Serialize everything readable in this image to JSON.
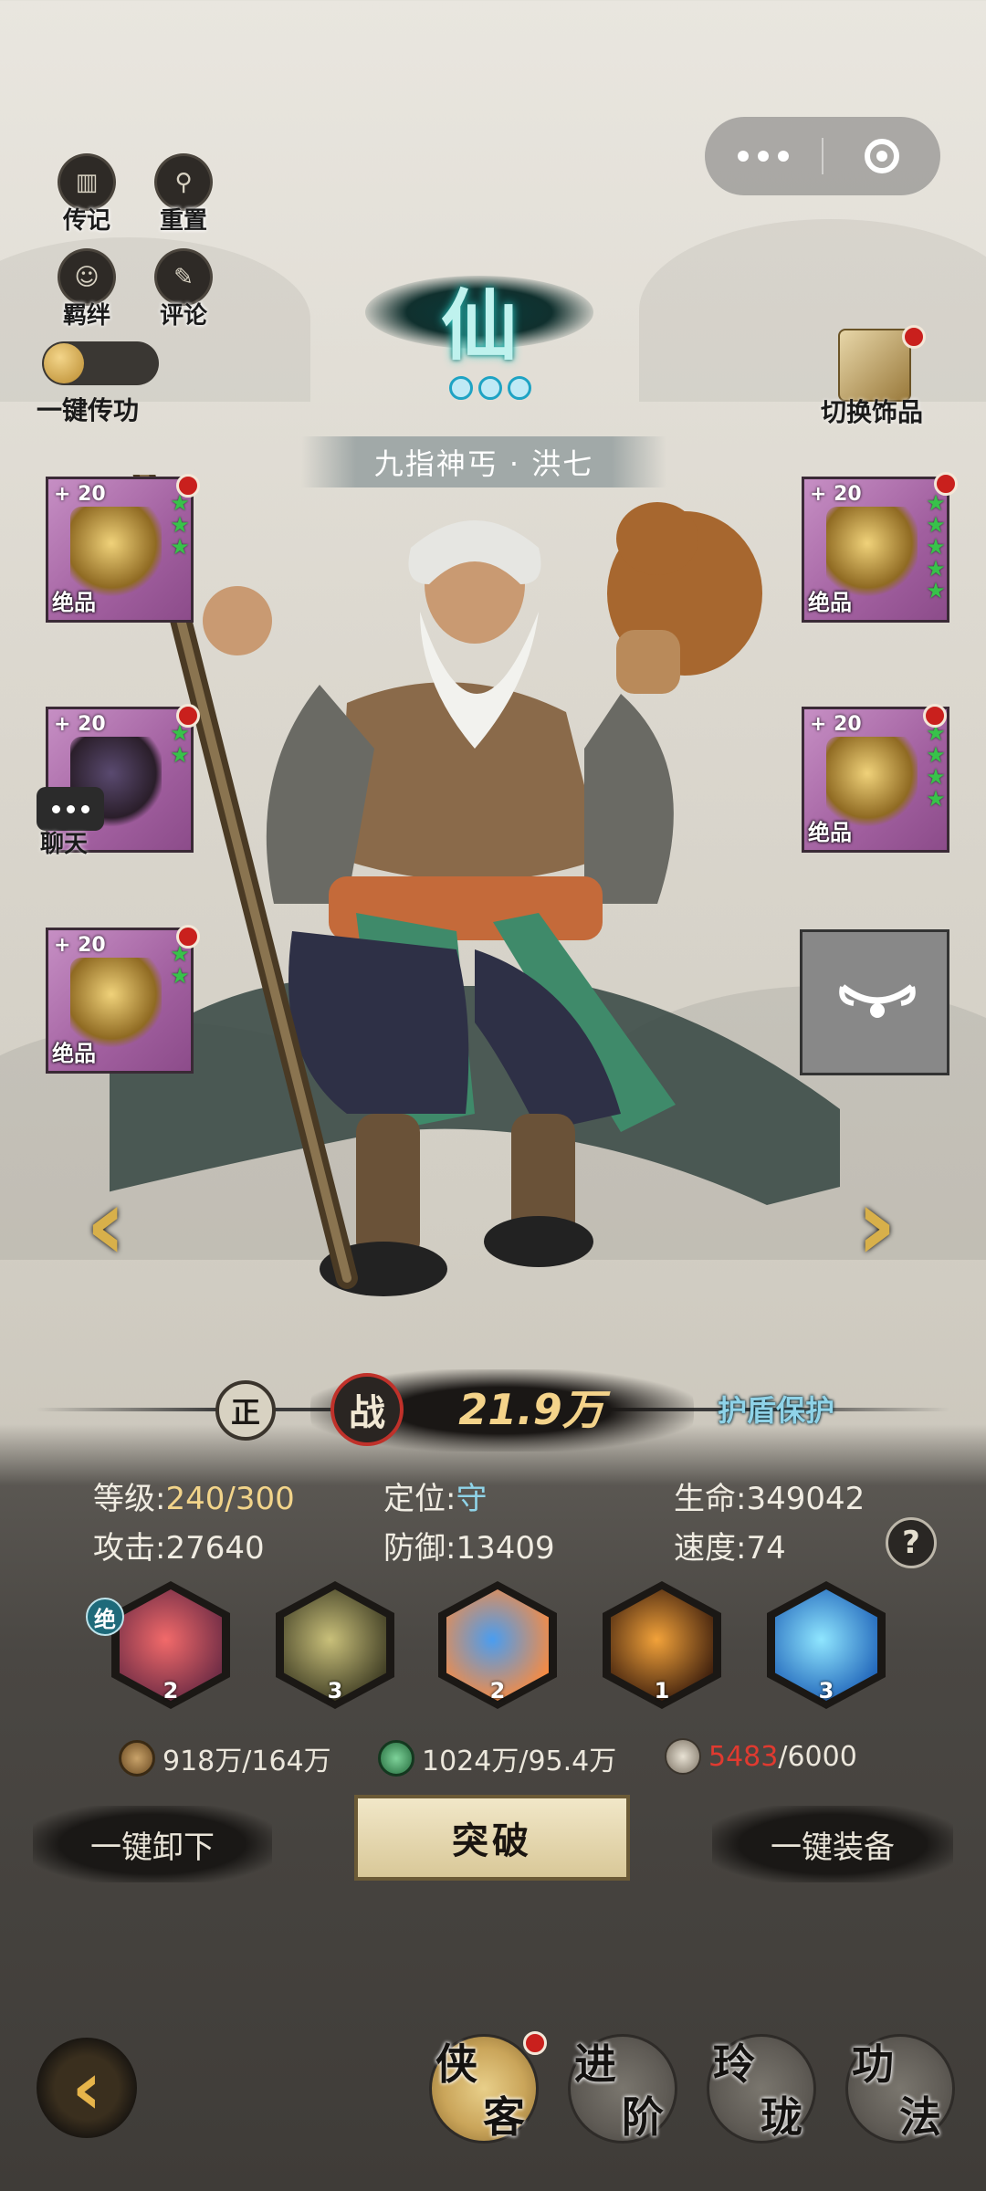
{
  "top_left_buttons": [
    {
      "label": "传记",
      "icon": "book-icon"
    },
    {
      "label": "重置",
      "icon": "reset-icon"
    },
    {
      "label": "羁绊",
      "icon": "bond-icon"
    },
    {
      "label": "评论",
      "icon": "comment-icon"
    }
  ],
  "toggle": {
    "label": "一键传功"
  },
  "rank": {
    "glyph": "仙",
    "drops": 3
  },
  "hero": {
    "name": "九指神丐 · 洪七"
  },
  "accessory": {
    "label": "切换饰品"
  },
  "equipment_left": [
    {
      "plus": "+ 20",
      "grade": "绝品",
      "stars": 3
    },
    {
      "plus": "+ 20",
      "grade": "",
      "stars": 2
    },
    {
      "plus": "+ 20",
      "grade": "绝品",
      "stars": 2
    }
  ],
  "equipment_right": [
    {
      "plus": "+ 20",
      "grade": "绝品",
      "stars": 5
    },
    {
      "plus": "+ 20",
      "grade": "绝品",
      "stars": 4
    }
  ],
  "chat": {
    "label": "聊天"
  },
  "power_band": {
    "zheng": "正",
    "zhan": "战",
    "power": "21.9万",
    "shield": "护盾保护"
  },
  "stats": {
    "level_label": "等级:",
    "level_value": "240/300",
    "role_label": "定位:",
    "role_value": "守",
    "hp_label": "生命:",
    "hp_value": "349042",
    "atk_label": "攻击:",
    "atk_value": "27640",
    "def_label": "防御:",
    "def_value": "13409",
    "spd_label": "速度:",
    "spd_value": "74"
  },
  "help": "?",
  "skills": [
    {
      "level": "2",
      "colors": [
        "#f26a6a",
        "#6a2a44"
      ]
    },
    {
      "level": "3",
      "colors": [
        "#c9c07a",
        "#3c3a22"
      ]
    },
    {
      "level": "2",
      "colors": [
        "#4a9df0",
        "#ff8a3a"
      ]
    },
    {
      "level": "1",
      "colors": [
        "#f2a23a",
        "#3a1c0c"
      ]
    },
    {
      "level": "3",
      "colors": [
        "#8fe6ff",
        "#1e62b8"
      ]
    }
  ],
  "skill_badge": "绝",
  "resources": {
    "coin": "918万/164万",
    "jade": "1024万/95.4万",
    "fragment_have": "5483",
    "fragment_need": "/6000"
  },
  "buttons": {
    "unequip_all": "一键卸下",
    "breakthrough": "突破",
    "equip_all": "一键装备"
  },
  "bottom_nav": [
    {
      "c1": "侠",
      "c2": "客",
      "active": true
    },
    {
      "c1": "进",
      "c2": "阶",
      "active": false
    },
    {
      "c1": "玲",
      "c2": "珑",
      "active": false
    },
    {
      "c1": "功",
      "c2": "法",
      "active": false
    }
  ]
}
